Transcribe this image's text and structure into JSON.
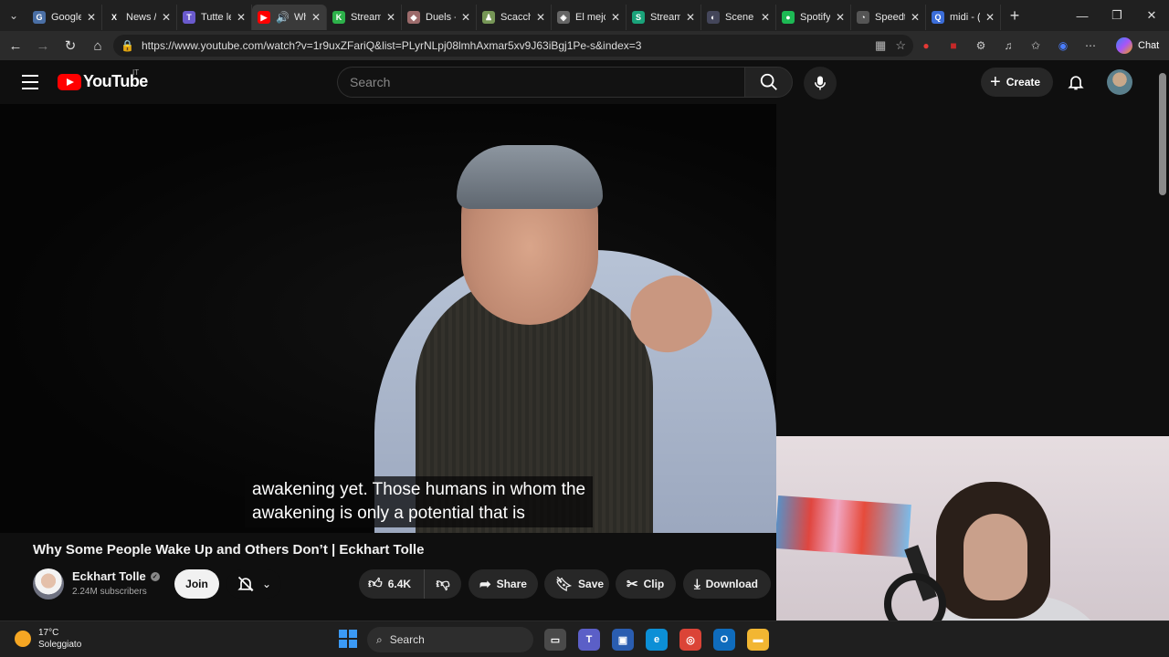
{
  "browser": {
    "tabs": [
      {
        "label": "Google",
        "fav_color": "#4a6fa5",
        "fav_glyph": "G"
      },
      {
        "label": "News /",
        "fav_color": "#202020",
        "fav_glyph": "X"
      },
      {
        "label": "Tutte le",
        "fav_color": "#6a5acd",
        "fav_glyph": "T"
      },
      {
        "label": "Wh",
        "fav_color": "#ff0000",
        "fav_glyph": "▶",
        "active": true
      },
      {
        "label": "Stream",
        "fav_color": "#2db14a",
        "fav_glyph": "K"
      },
      {
        "label": "Duels -",
        "fav_color": "#9c6b6b",
        "fav_glyph": "◆"
      },
      {
        "label": "Scacchi",
        "fav_color": "#769656",
        "fav_glyph": "♟"
      },
      {
        "label": "El mejo",
        "fav_color": "#666666",
        "fav_glyph": "◈"
      },
      {
        "label": "StreamI",
        "fav_color": "#1aa37a",
        "fav_glyph": "S"
      },
      {
        "label": "Scene E",
        "fav_color": "#44465a",
        "fav_glyph": "◐"
      },
      {
        "label": "Spotify",
        "fav_color": "#1db954",
        "fav_glyph": "●"
      },
      {
        "label": "Speedt",
        "fav_color": "#555555",
        "fav_glyph": "◔"
      },
      {
        "label": "midi - (",
        "fav_color": "#3b6dd8",
        "fav_glyph": "Q"
      }
    ],
    "new_tab": "+",
    "window_controls": [
      "—",
      "❐",
      "✕"
    ],
    "url": "https://www.youtube.com/watch?v=1r9uxZFariQ&list=PLyrNLpj08lmhAxmar5xv9J63iBgj1Pe-s&index=3",
    "chat_label": "Chat"
  },
  "youtube": {
    "logo_text": "YouTube",
    "country_code": "IT",
    "search_placeholder": "Search",
    "create_label": "Create",
    "caption_lines": [
      "awakening yet. Those humans in whom the",
      "awakening is only a potential that is"
    ],
    "video_title": "Why Some People Wake Up and Others Don’t | Eckhart Tolle",
    "channel_name": "Eckhart Tolle",
    "subscribers": "2.24M subscribers",
    "join_label": "Join",
    "like_count": "6.4K",
    "share_label": "Share",
    "save_label": "Save",
    "clip_label": "Clip",
    "download_label": "Download"
  },
  "taskbar": {
    "temperature": "17°C",
    "weather_desc": "Soleggiato",
    "search_label": "Search"
  }
}
